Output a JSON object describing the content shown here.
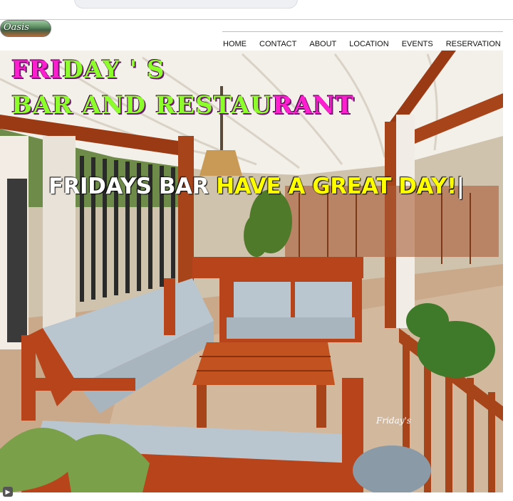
{
  "logo": {
    "text": "Oasis"
  },
  "nav": {
    "items": [
      "HOME",
      "CONTACT",
      "ABOUT",
      "LOCATION",
      "EVENTS",
      "RESERVATION"
    ]
  },
  "hero": {
    "title_line1_a": "FRI",
    "title_line1_b": "DAY ' S",
    "title_line2_a": "BAR AND RESTAU",
    "title_line2_b": "RANT",
    "tagline_white": "FRIDAYS BAR ",
    "tagline_yellow": "HAVE A GREAT DAY!",
    "tagline_cursor": "|",
    "sign_text": "Friday's"
  },
  "colors": {
    "magenta": "#ff1fd0",
    "green": "#8cff2a",
    "yellow": "#ffff00",
    "wood": "#b8441c",
    "cushion": "#b9c6cf"
  }
}
